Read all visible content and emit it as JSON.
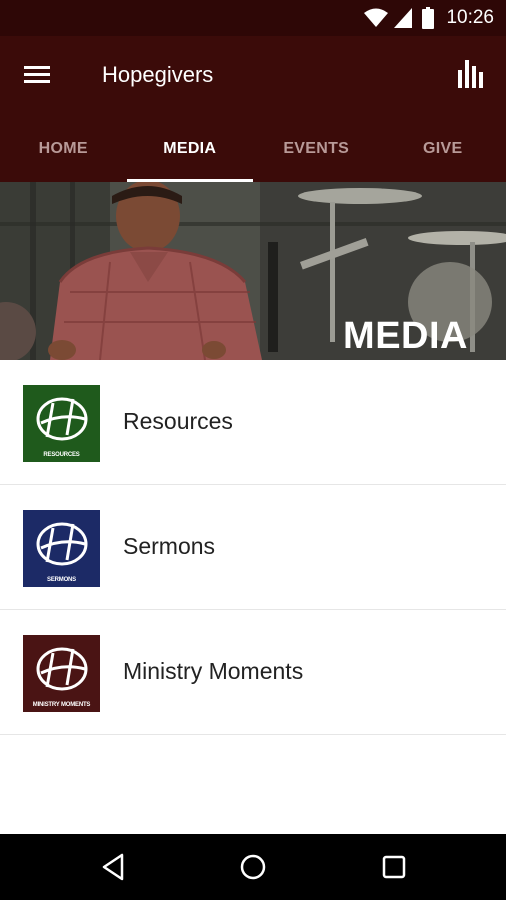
{
  "status_bar": {
    "time": "10:26",
    "icons": [
      "wifi-icon",
      "signal-icon",
      "battery-icon"
    ]
  },
  "app_bar": {
    "title": "Hopegivers",
    "menu_icon": "hamburger-menu-icon",
    "action_icon": "bar-chart-icon",
    "background": "#3b0b09"
  },
  "tabs": [
    {
      "label": "HOME",
      "active": false
    },
    {
      "label": "MEDIA",
      "active": true
    },
    {
      "label": "EVENTS",
      "active": false
    },
    {
      "label": "GIVE",
      "active": false
    }
  ],
  "hero": {
    "title": "MEDIA"
  },
  "media_items": [
    {
      "label": "Resources",
      "thumb_caption": "RESOURCES",
      "thumb_color": "#1f5a1c"
    },
    {
      "label": "Sermons",
      "thumb_caption": "SERMONS",
      "thumb_color": "#1c2a66"
    },
    {
      "label": "Ministry Moments",
      "thumb_caption": "MINISTRY MOMENTS",
      "thumb_color": "#4a1414"
    }
  ],
  "nav_bar": {
    "icons": [
      "back-icon",
      "home-icon",
      "recents-icon"
    ]
  }
}
